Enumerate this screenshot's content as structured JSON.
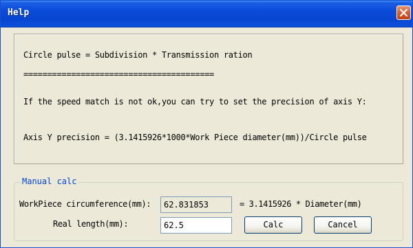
{
  "window": {
    "title": "Help",
    "close_icon": "close-icon",
    "colors": {
      "titlebar": "#0846cf",
      "close": "#d4582b",
      "face": "#ece9d8",
      "group_title": "#0046d5"
    }
  },
  "info": {
    "line1": "Circle pulse = Subdivision * Transmission ration",
    "line2": "========================================",
    "line3": "If the speed match is not ok,you can try to set the precision of axis Y:",
    "line4": "Axis Y precision = (3.1415926*1000*Work Piece diameter(mm))/Circle pulse"
  },
  "manual": {
    "title": "Manual calc",
    "circumference_label": "WorkPiece circumference(mm):",
    "circumference_value": "62.831853",
    "formula": "= 3.1415926 * Diameter(mm)",
    "real_length_label": "Real length(mm):",
    "real_length_value": "62.5",
    "calc_label": "Calc",
    "cancel_label": "Cancel"
  }
}
